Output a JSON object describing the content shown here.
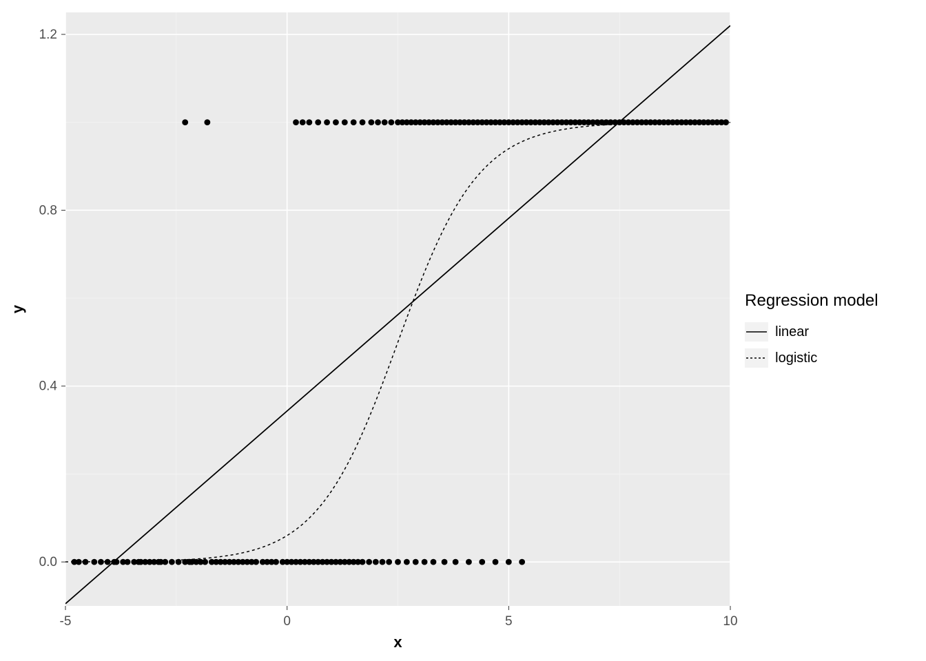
{
  "chart_data": {
    "type": "scatter",
    "title": "",
    "xlabel": "x",
    "ylabel": "y",
    "xlim": [
      -5,
      10
    ],
    "ylim": [
      -0.1,
      1.25
    ],
    "x_ticks": [
      -5,
      0,
      5,
      10
    ],
    "y_ticks": [
      0.0,
      0.4,
      0.8,
      1.2
    ],
    "y_tick_labels": [
      "0.0",
      "0.4",
      "0.8",
      "1.2"
    ],
    "series": [
      {
        "name": "linear",
        "linetype": "solid",
        "type": "line",
        "x": [
          -5,
          10
        ],
        "y": [
          -0.095,
          1.22
        ]
      },
      {
        "name": "logistic",
        "linetype": "dashed",
        "type": "line",
        "x_start": -5,
        "x_end": 10,
        "k": 1.1,
        "x0": 2.5
      }
    ],
    "points_y": [
      {
        "y": 0,
        "x": [
          -4.8,
          -4.7,
          -4.55,
          -4.35,
          -4.2,
          -4.05,
          -3.9,
          -3.85,
          -3.7,
          -3.6,
          -3.45,
          -3.35,
          -3.3,
          -3.2,
          -3.1,
          -3.0,
          -2.9,
          -2.85,
          -2.75,
          -2.6,
          -2.45,
          -2.3,
          -2.2,
          -2.15,
          -2.05,
          -1.95,
          -1.85,
          -1.7,
          -1.6,
          -1.5,
          -1.4,
          -1.3,
          -1.2,
          -1.1,
          -1.0,
          -0.9,
          -0.8,
          -0.7,
          -0.55,
          -0.45,
          -0.35,
          -0.25,
          -0.1,
          0.0,
          0.1,
          0.2,
          0.3,
          0.4,
          0.5,
          0.6,
          0.7,
          0.8,
          0.9,
          1.0,
          1.1,
          1.2,
          1.3,
          1.4,
          1.5,
          1.6,
          1.7,
          1.85,
          2.0,
          2.15,
          2.3,
          2.5,
          2.7,
          2.9,
          3.1,
          3.3,
          3.55,
          3.8,
          4.1,
          4.4,
          4.7,
          5.0,
          5.3
        ]
      },
      {
        "y": 1,
        "x": [
          -2.3,
          -1.8,
          0.2,
          0.35,
          0.5,
          0.7,
          0.9,
          1.1,
          1.3,
          1.5,
          1.7,
          1.9,
          2.05,
          2.2,
          2.35,
          2.5,
          2.6,
          2.7,
          2.8,
          2.9,
          3.0,
          3.1,
          3.2,
          3.3,
          3.4,
          3.5,
          3.6,
          3.7,
          3.8,
          3.9,
          4.0,
          4.1,
          4.2,
          4.3,
          4.4,
          4.5,
          4.6,
          4.7,
          4.8,
          4.9,
          5.0,
          5.1,
          5.2,
          5.3,
          5.4,
          5.5,
          5.6,
          5.7,
          5.8,
          5.9,
          6.0,
          6.1,
          6.2,
          6.3,
          6.4,
          6.5,
          6.6,
          6.7,
          6.8,
          6.9,
          7.0,
          7.1,
          7.2,
          7.3,
          7.4,
          7.5,
          7.6,
          7.7,
          7.8,
          7.9,
          8.0,
          8.1,
          8.2,
          8.3,
          8.4,
          8.5,
          8.6,
          8.7,
          8.8,
          8.9,
          9.0,
          9.1,
          9.2,
          9.3,
          9.4,
          9.5,
          9.6,
          9.7,
          9.8,
          9.9
        ]
      }
    ],
    "legend": {
      "title": "Regression model",
      "items": [
        {
          "label": "linear",
          "linetype": "solid"
        },
        {
          "label": "logistic",
          "linetype": "dashed"
        }
      ]
    },
    "panel_bg": "#ebebeb",
    "grid_major_color": "#ffffff",
    "grid_minor_color": "#f5f5f5"
  }
}
